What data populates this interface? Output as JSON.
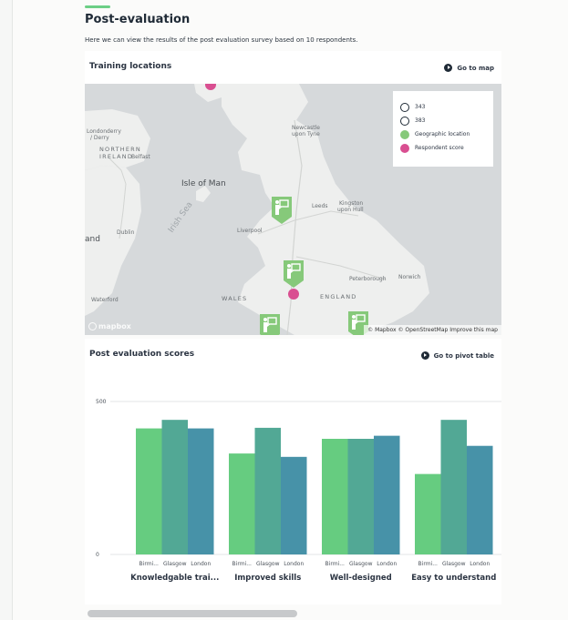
{
  "header": {
    "title": "Post-evaluation",
    "subtitle": "Here we can view the results of the post evaluation survey based on 10 respondents."
  },
  "map_card": {
    "title": "Training locations",
    "action_label": "Go to map",
    "legend": [
      {
        "label": "343",
        "icon": "empty-circle"
      },
      {
        "label": "383",
        "icon": "empty-circle"
      },
      {
        "label": "Geographic location",
        "icon": "filled-circle",
        "color": "#86c97a"
      },
      {
        "label": "Respondent score",
        "icon": "filled-circle",
        "color": "#d94f91"
      }
    ],
    "place_labels": {
      "londonderry": "Londonderry",
      "derry": "/ Derry",
      "northern_ireland_1": "NORTHERN",
      "northern_ireland_2": "IRELAND",
      "belfast": "Belfast",
      "isle_of_man": "Isle of Man",
      "irish_sea": "Irish Sea",
      "newcastle_1": "Newcastle",
      "newcastle_2": "upon Tyne",
      "leeds": "Leeds",
      "kingston_1": "Kingston",
      "kingston_2": "upon Hull",
      "liverpool": "Liverpool",
      "dublin": "Dublin",
      "ireland_partial": "and",
      "peterborough": "Peterborough",
      "norwich": "Norwich",
      "england": "ENGLAND",
      "wales": "WALES",
      "waterford": "Waterford"
    },
    "mapbox_logo": "mapbox",
    "attribution": "© Mapbox © OpenStreetMap Improve this map"
  },
  "chart_card": {
    "title": "Post evaluation scores",
    "action_label": "Go to pivot table"
  },
  "chart_data": {
    "type": "bar",
    "title": "Post evaluation scores",
    "ylim": [
      0,
      500
    ],
    "y_ticks": [
      "0",
      "500"
    ],
    "groups": [
      "Knowledgable trai...",
      "Improved skills",
      "Well-designed",
      "Easy to understand"
    ],
    "series_labels": [
      "Birmi...",
      "Glasgow",
      "London"
    ],
    "series": [
      {
        "values": [
          412,
          330,
          378,
          263
        ]
      },
      {
        "values": [
          440,
          414,
          378,
          440
        ]
      },
      {
        "values": [
          412,
          319,
          388,
          355
        ]
      }
    ],
    "colors": [
      "#66cc80",
      "#52a895",
      "#4792a8"
    ],
    "grid": true
  },
  "colors": {
    "accent": "#6ccf86",
    "map_bg": "#d6d9db",
    "land": "#eeefee",
    "marker": "#86c97a",
    "respondent": "#d94f91"
  }
}
